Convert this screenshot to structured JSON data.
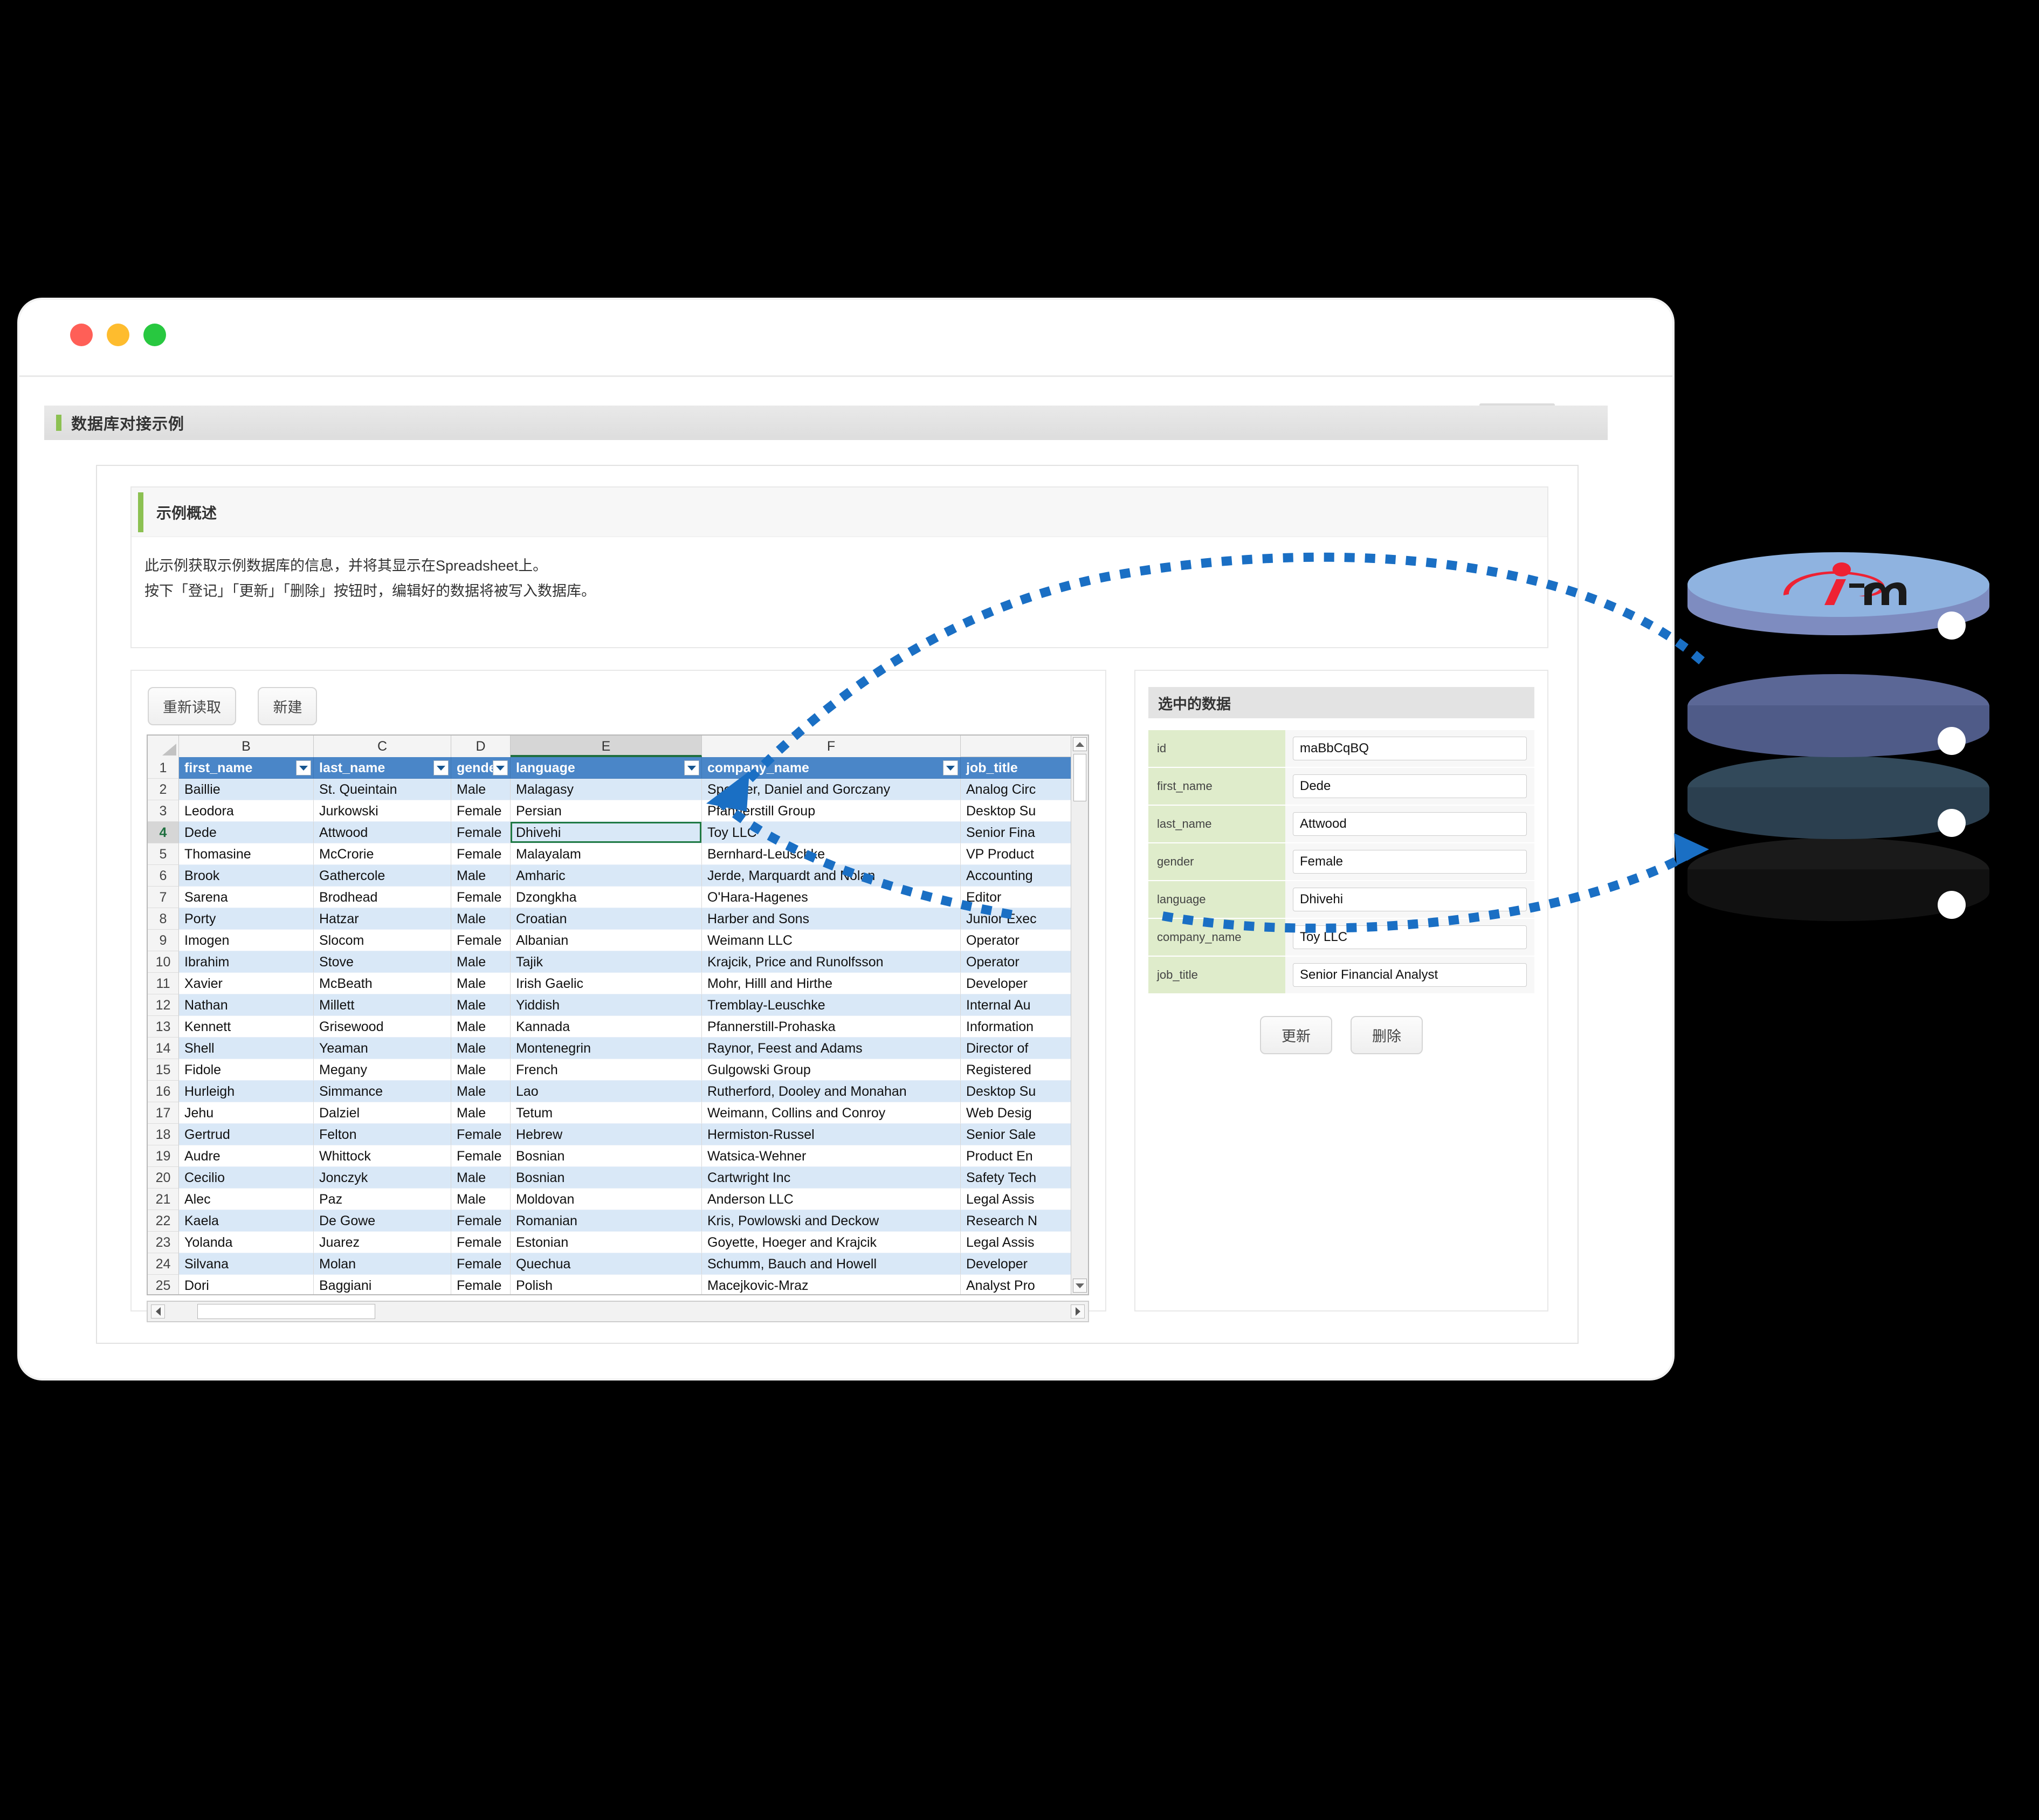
{
  "window": {
    "traffic_lights": [
      "close",
      "minimize",
      "maximize"
    ]
  },
  "app_header": {
    "title": "数据库对接示例"
  },
  "overview": {
    "title": "示例概述",
    "line1": "此示例获取示例数据库的信息，并将其显示在Spreadsheet上。",
    "line2": "按下「登记」「更新」「删除」按钮时，编辑好的数据将被写入数据库。"
  },
  "toolbar": {
    "reload_label": "重新读取",
    "new_label": "新建"
  },
  "spreadsheet": {
    "column_letters": [
      "B",
      "C",
      "D",
      "E",
      "F"
    ],
    "active_column": "E",
    "active_row": 4,
    "selected_cell": {
      "column": "E",
      "row": 4,
      "value": "Dhivehi"
    },
    "headers": [
      "first_name",
      "last_name",
      "gender",
      "language",
      "company_name",
      "job_title"
    ],
    "rows": [
      {
        "n": 2,
        "cells": [
          "Baillie",
          "St. Queintain",
          "Male",
          "Malagasy",
          "Spencer, Daniel and Gorczany",
          "Analog Circ"
        ]
      },
      {
        "n": 3,
        "cells": [
          "Leodora",
          "Jurkowski",
          "Female",
          "Persian",
          "Pfannerstill Group",
          "Desktop Su"
        ]
      },
      {
        "n": 4,
        "cells": [
          "Dede",
          "Attwood",
          "Female",
          "Dhivehi",
          "Toy LLC",
          "Senior Fina"
        ]
      },
      {
        "n": 5,
        "cells": [
          "Thomasine",
          "McCrorie",
          "Female",
          "Malayalam",
          "Bernhard-Leuschke",
          "VP Product"
        ]
      },
      {
        "n": 6,
        "cells": [
          "Brook",
          "Gathercole",
          "Male",
          "Amharic",
          "Jerde, Marquardt and Nolan",
          "Accounting"
        ]
      },
      {
        "n": 7,
        "cells": [
          "Sarena",
          "Brodhead",
          "Female",
          "Dzongkha",
          "O'Hara-Hagenes",
          "Editor"
        ]
      },
      {
        "n": 8,
        "cells": [
          "Porty",
          "Hatzar",
          "Male",
          "Croatian",
          "Harber and Sons",
          "Junior Exec"
        ]
      },
      {
        "n": 9,
        "cells": [
          "Imogen",
          "Slocom",
          "Female",
          "Albanian",
          "Weimann LLC",
          "Operator"
        ]
      },
      {
        "n": 10,
        "cells": [
          "Ibrahim",
          "Stove",
          "Male",
          "Tajik",
          "Krajcik, Price and Runolfsson",
          "Operator"
        ]
      },
      {
        "n": 11,
        "cells": [
          "Xavier",
          "McBeath",
          "Male",
          "Irish Gaelic",
          "Mohr, Hilll and Hirthe",
          "Developer"
        ]
      },
      {
        "n": 12,
        "cells": [
          "Nathan",
          "Millett",
          "Male",
          "Yiddish",
          "Tremblay-Leuschke",
          "Internal Au"
        ]
      },
      {
        "n": 13,
        "cells": [
          "Kennett",
          "Grisewood",
          "Male",
          "Kannada",
          "Pfannerstill-Prohaska",
          "Information"
        ]
      },
      {
        "n": 14,
        "cells": [
          "Shell",
          "Yeaman",
          "Male",
          "Montenegrin",
          "Raynor, Feest and Adams",
          "Director of"
        ]
      },
      {
        "n": 15,
        "cells": [
          "Fidole",
          "Megany",
          "Male",
          "French",
          "Gulgowski Group",
          "Registered"
        ]
      },
      {
        "n": 16,
        "cells": [
          "Hurleigh",
          "Simmance",
          "Male",
          "Lao",
          "Rutherford, Dooley and Monahan",
          "Desktop Su"
        ]
      },
      {
        "n": 17,
        "cells": [
          "Jehu",
          "Dalziel",
          "Male",
          "Tetum",
          "Weimann, Collins and Conroy",
          "Web Desig"
        ]
      },
      {
        "n": 18,
        "cells": [
          "Gertrud",
          "Felton",
          "Female",
          "Hebrew",
          "Hermiston-Russel",
          "Senior Sale"
        ]
      },
      {
        "n": 19,
        "cells": [
          "Audre",
          "Whittock",
          "Female",
          "Bosnian",
          "Watsica-Wehner",
          "Product En"
        ]
      },
      {
        "n": 20,
        "cells": [
          "Cecilio",
          "Jonczyk",
          "Male",
          "Bosnian",
          "Cartwright Inc",
          "Safety Tech"
        ]
      },
      {
        "n": 21,
        "cells": [
          "Alec",
          "Paz",
          "Male",
          "Moldovan",
          "Anderson LLC",
          "Legal Assis"
        ]
      },
      {
        "n": 22,
        "cells": [
          "Kaela",
          "De Gowe",
          "Female",
          "Romanian",
          "Kris, Powlowski and Deckow",
          "Research N"
        ]
      },
      {
        "n": 23,
        "cells": [
          "Yolanda",
          "Juarez",
          "Female",
          "Estonian",
          "Goyette, Hoeger and Krajcik",
          "Legal Assis"
        ]
      },
      {
        "n": 24,
        "cells": [
          "Silvana",
          "Molan",
          "Female",
          "Quechua",
          "Schumm, Bauch and Howell",
          "Developer"
        ]
      },
      {
        "n": 25,
        "cells": [
          "Dori",
          "Baggiani",
          "Female",
          "Polish",
          "Macejkovic-Mraz",
          "Analyst Pro"
        ]
      }
    ]
  },
  "selected_data": {
    "title": "选中的数据",
    "fields": [
      {
        "label": "id",
        "value": "maBbCqBQ"
      },
      {
        "label": "first_name",
        "value": "Dede"
      },
      {
        "label": "last_name",
        "value": "Attwood"
      },
      {
        "label": "gender",
        "value": "Female"
      },
      {
        "label": "language",
        "value": "Dhivehi"
      },
      {
        "label": "company_name",
        "value": "Toy LLC"
      },
      {
        "label": "job_title",
        "value": "Senior Financial Analyst"
      }
    ],
    "update_label": "更新",
    "delete_label": "删除"
  },
  "database_graphic": {
    "logo_text_i": "i",
    "logo_text_m": "m",
    "disk_colors": [
      "#8fb3e0",
      "#5b6796",
      "#32495a",
      "#1a1a1a"
    ],
    "top_face_color": "#8fb3e0"
  },
  "colors": {
    "accent_green": "#8cc152",
    "header_blue": "#4a86c8",
    "row_stripe": "#d9e8f7",
    "arrow_blue": "#1a6fc4",
    "selection_green": "#1f7a44",
    "form_label_green": "#dfeccb",
    "logo_red": "#ee2233"
  }
}
